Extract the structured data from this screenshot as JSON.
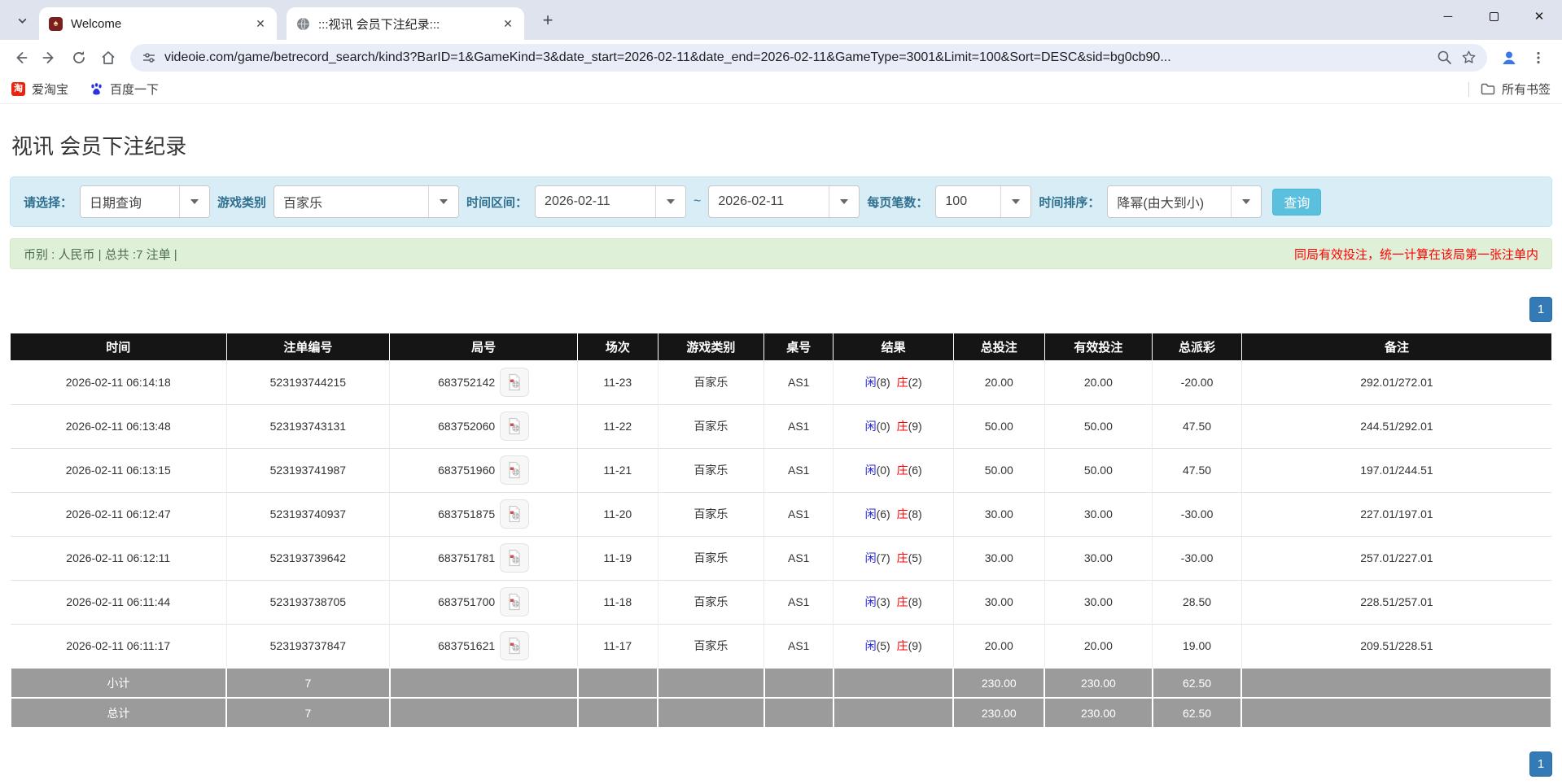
{
  "browser": {
    "tabs": [
      {
        "title": "Welcome",
        "favicon_glyph": "♠"
      },
      {
        "title": ":::视讯 会员下注纪录:::"
      }
    ],
    "url": "videoie.com/game/betrecord_search/kind3?BarID=1&GameKind=3&date_start=2026-02-11&date_end=2026-02-11&GameType=3001&Limit=100&Sort=DESC&sid=bg0cb90...",
    "new_tab": "+",
    "tab_close": "✕",
    "win_minimize": "─",
    "win_close": "✕",
    "bookmarks": [
      {
        "label": "爱淘宝",
        "icon_glyph": "淘"
      },
      {
        "label": "百度一下"
      }
    ],
    "all_bookmarks_label": "所有书签"
  },
  "page": {
    "title": "视讯 会员下注纪录",
    "filters": {
      "select_label": "请选择：",
      "select_value": "日期查询",
      "game_label": "游戏类别",
      "game_value": "百家乐",
      "range_label": "时间区间：",
      "date_start": "2026-02-11",
      "range_separator": "~",
      "date_end": "2026-02-11",
      "limit_label": "每页笔数：",
      "limit_value": "100",
      "sort_label": "时间排序：",
      "sort_value": "降幂(由大到小)",
      "search_button": "查询"
    },
    "summary": {
      "left": "币别 : 人民币 | 总共 :7 注单 |",
      "right": "同局有效投注，统一计算在该局第一张注单内"
    },
    "pagination": {
      "page": "1"
    },
    "table": {
      "headers": {
        "time": "时间",
        "bet_id": "注单编号",
        "round": "局号",
        "session": "场次",
        "game": "游戏类别",
        "table_no": "桌号",
        "result": "结果",
        "total": "总投注",
        "valid": "有效投注",
        "payout": "总派彩",
        "note": "备注"
      },
      "player_label": "闲",
      "banker_label": "庄",
      "rows": [
        {
          "time": "2026-02-11 06:14:18",
          "bet_id": "523193744215",
          "round": "683752142",
          "session": "11-23",
          "game": "百家乐",
          "table_no": "AS1",
          "player": "(8)",
          "banker": "(2)",
          "total": "20.00",
          "valid": "20.00",
          "payout": "-20.00",
          "payout_class": "neg",
          "note": "292.01/272.01"
        },
        {
          "time": "2026-02-11 06:13:48",
          "bet_id": "523193743131",
          "round": "683752060",
          "session": "11-22",
          "game": "百家乐",
          "table_no": "AS1",
          "player": "(0)",
          "banker": "(9)",
          "total": "50.00",
          "valid": "50.00",
          "payout": "47.50",
          "payout_class": "pos",
          "note": "244.51/292.01"
        },
        {
          "time": "2026-02-11 06:13:15",
          "bet_id": "523193741987",
          "round": "683751960",
          "session": "11-21",
          "game": "百家乐",
          "table_no": "AS1",
          "player": "(0)",
          "banker": "(6)",
          "total": "50.00",
          "valid": "50.00",
          "payout": "47.50",
          "payout_class": "pos",
          "note": "197.01/244.51"
        },
        {
          "time": "2026-02-11 06:12:47",
          "bet_id": "523193740937",
          "round": "683751875",
          "session": "11-20",
          "game": "百家乐",
          "table_no": "AS1",
          "player": "(6)",
          "banker": "(8)",
          "total": "30.00",
          "valid": "30.00",
          "payout": "-30.00",
          "payout_class": "neg",
          "note": "227.01/197.01"
        },
        {
          "time": "2026-02-11 06:12:11",
          "bet_id": "523193739642",
          "round": "683751781",
          "session": "11-19",
          "game": "百家乐",
          "table_no": "AS1",
          "player": "(7)",
          "banker": "(5)",
          "total": "30.00",
          "valid": "30.00",
          "payout": "-30.00",
          "payout_class": "neg",
          "note": "257.01/227.01"
        },
        {
          "time": "2026-02-11 06:11:44",
          "bet_id": "523193738705",
          "round": "683751700",
          "session": "11-18",
          "game": "百家乐",
          "table_no": "AS1",
          "player": "(3)",
          "banker": "(8)",
          "total": "30.00",
          "valid": "30.00",
          "payout": "28.50",
          "payout_class": "pos",
          "note": "228.51/257.01"
        },
        {
          "time": "2026-02-11 06:11:17",
          "bet_id": "523193737847",
          "round": "683751621",
          "session": "11-17",
          "game": "百家乐",
          "table_no": "AS1",
          "player": "(5)",
          "banker": "(9)",
          "total": "20.00",
          "valid": "20.00",
          "payout": "19.00",
          "payout_class": "pos",
          "note": "209.51/228.51"
        }
      ],
      "subtotal": {
        "label": "小计",
        "count": "7",
        "total": "230.00",
        "valid": "230.00",
        "payout": "62.50"
      },
      "total": {
        "label": "总计",
        "count": "7",
        "total": "230.00",
        "valid": "230.00",
        "payout": "62.50"
      }
    }
  }
}
